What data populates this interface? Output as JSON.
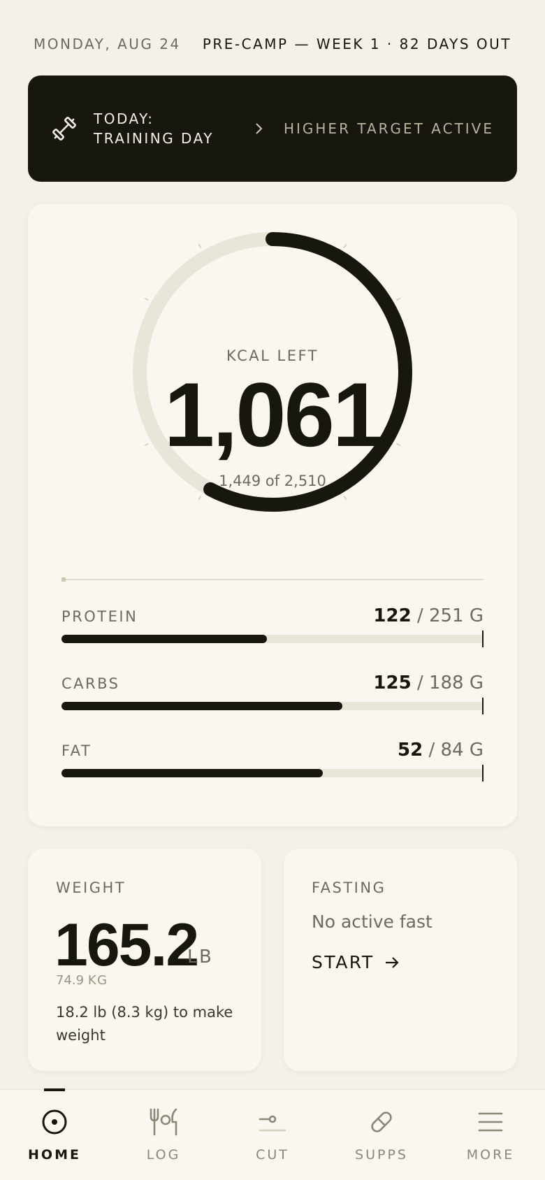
{
  "header": {
    "date": "MONDAY, AUG 24",
    "camp_status": "PRE-CAMP — WEEK 1 · 82 DAYS OUT"
  },
  "banner": {
    "icon": "dumbbell-icon",
    "line1": "TODAY:",
    "line2": "TRAINING DAY",
    "status": "HIGHER TARGET ACTIVE"
  },
  "calories": {
    "label": "KCAL LEFT",
    "remaining": "1,061",
    "summary": "1,449 of 2,510",
    "consumed": 1449,
    "target": 2510
  },
  "macros": [
    {
      "name": "PROTEIN",
      "current": "122",
      "target": "/ 251 G",
      "fraction": 0.486
    },
    {
      "name": "CARBS",
      "current": "125",
      "target": "/ 188 G",
      "fraction": 0.665
    },
    {
      "name": "FAT",
      "current": "52",
      "target": "/ 84 G",
      "fraction": 0.619
    }
  ],
  "weight": {
    "label": "WEIGHT",
    "value": "165.2",
    "unit": "LB",
    "kg_value": "74.9",
    "kg_unit": "KG",
    "note": "18.2 lb (8.3 kg) to make weight"
  },
  "fasting": {
    "label": "FASTING",
    "status": "No active fast",
    "action": "START"
  },
  "tabs": [
    {
      "label": "HOME",
      "icon": "home-target-icon",
      "active": true
    },
    {
      "label": "LOG",
      "icon": "fork-knife-icon",
      "active": false
    },
    {
      "label": "CUT",
      "icon": "cut-scale-icon",
      "active": false
    },
    {
      "label": "SUPPS",
      "icon": "pill-icon",
      "active": false
    },
    {
      "label": "MORE",
      "icon": "menu-icon",
      "active": false
    }
  ],
  "colors": {
    "background": "#f3f1ea",
    "card": "#f9f7ef",
    "ink": "#17160f",
    "muted": "#6e6a5e",
    "track": "#e9e5d8"
  }
}
